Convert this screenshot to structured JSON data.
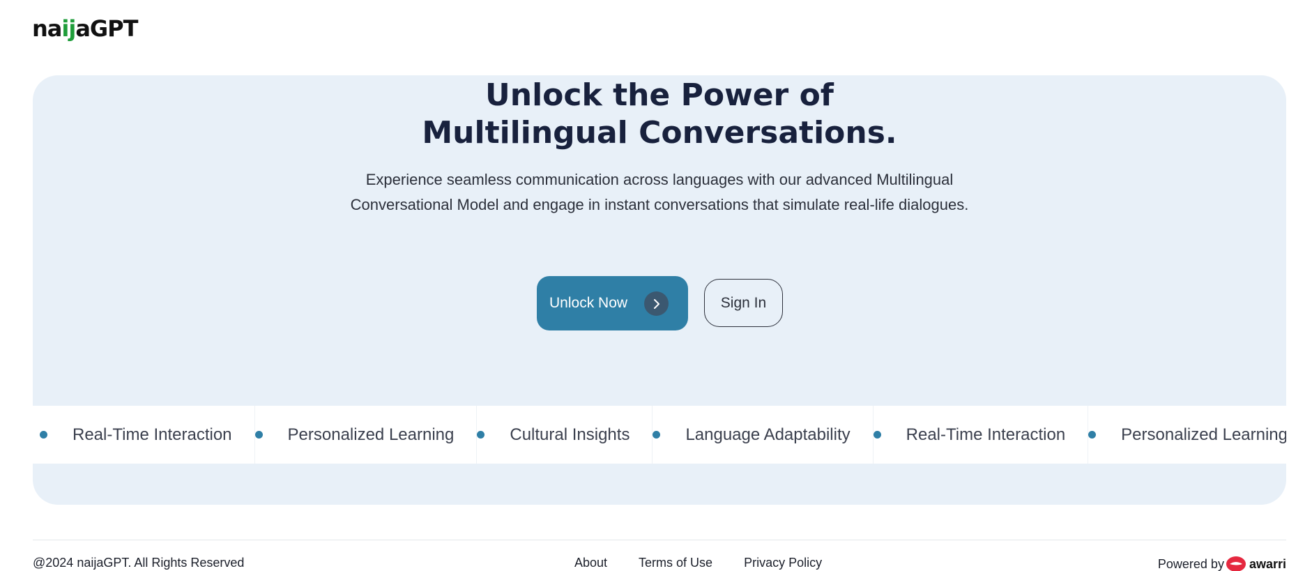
{
  "header": {
    "logo_part1": "na",
    "logo_highlight": "ij",
    "logo_part2": "aGPT"
  },
  "hero": {
    "title_line1": "Unlock the Power of",
    "title_line2": "Multilingual Conversations.",
    "subtitle": "Experience seamless communication across languages with our advanced Multilingual Conversational Model and engage in instant conversations that simulate real-life dialogues.",
    "primary_button": "Unlock Now",
    "primary_button_icon": "chevron-right-icon",
    "secondary_button": "Sign In"
  },
  "features_marquee": {
    "items": [
      "Real-Time Interaction",
      "Personalized Learning",
      "Cultural Insights",
      "Language Adaptability",
      "Real-Time Interaction",
      "Personalized Learning"
    ]
  },
  "footer": {
    "copyright": "@2024 naijaGPT. All Rights Reserved",
    "links": [
      "About",
      "Terms of Use",
      "Privacy Policy"
    ],
    "powered_by": "Powered by",
    "brand": "awarri",
    "brand_icon": "awarri-lips-icon"
  },
  "colors": {
    "accent": "#2f7fa6",
    "hero_bg": "#e8f0f8",
    "title": "#18213d",
    "logo_highlight": "#1f9d3a",
    "brand_red": "#e5283f"
  }
}
